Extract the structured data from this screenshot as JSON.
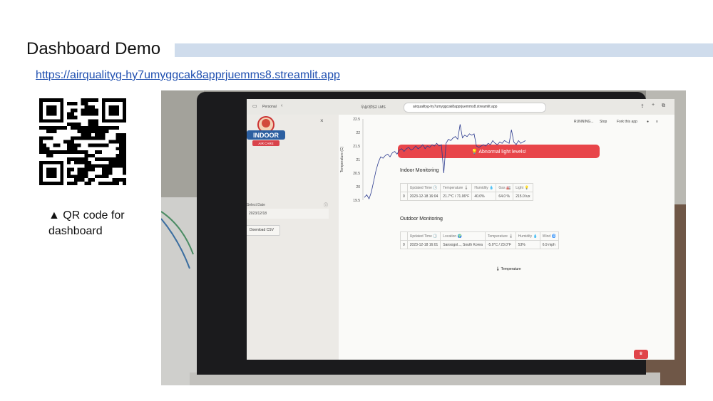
{
  "slide": {
    "title": "Dashboard Demo",
    "link": "https://airqualityg-hy7umyggcak8apprjuemms8.streamlit.app",
    "qr_caption": "▲ QR code for dashboard"
  },
  "browser": {
    "profile": "Personal",
    "tab1": "우송대학교 LMS",
    "url": "airqualityg-hy7umyggcak8apprjuemms8.streamlit.app"
  },
  "app": {
    "status": {
      "running": "RUNNING...",
      "stop": "Stop",
      "fork": "Fork this app"
    },
    "sidebar": {
      "logo_main": "INDOOR",
      "logo_sub": "AIR CARE",
      "select_date_label": "Select Date",
      "date_value": "2023/12/18",
      "download_label": "Download CSV"
    },
    "alert": "💡 Abnormal light levels!",
    "indoor": {
      "heading": "Indoor Monitoring",
      "headers": [
        "",
        "Updated Time 🕒",
        "Temperature 🌡",
        "Humidity 💧",
        "Gas 🏭",
        "Light 💡"
      ],
      "row": [
        "0",
        "2023-12-18 16:04",
        "21.7°C / 71.06°F",
        "40.0%",
        "64.0 %",
        "215.0 lux"
      ]
    },
    "outdoor": {
      "heading": "Outdoor Monitoring",
      "headers": [
        "",
        "Updated Time 🕒",
        "Location 🌍",
        "Temperature 🌡",
        "Humidity 💧",
        "Wind 🌀"
      ],
      "row": [
        "0",
        "2023-12-18 16:01",
        "Sansogol..., South Korea",
        "-5.0°C / 23.0°F",
        "53%",
        "6.9 mph"
      ]
    }
  },
  "chart_data": {
    "type": "line",
    "title": "🌡 Temperature",
    "ylabel": "Temperature (C)",
    "ylim": [
      19.5,
      22.5
    ],
    "yticks": [
      19.5,
      20,
      20.5,
      21,
      21.5,
      22,
      22.5
    ],
    "grid": false,
    "series": [
      {
        "values": [
          19.6,
          19.7,
          19.55,
          19.8,
          20.2,
          20.6,
          20.9,
          21.1,
          21.05,
          21.15,
          21.2,
          21.1,
          21.25,
          21.3,
          21.2,
          21.35,
          21.4,
          21.3,
          21.4,
          21.45,
          21.35,
          21.4,
          21.5,
          21.4,
          21.45,
          21.55,
          21.4,
          21.5,
          21.45,
          21.55,
          21.5,
          21.6,
          21.5,
          21.55,
          20.5,
          21.6,
          21.75,
          21.7,
          21.8,
          21.85,
          21.75,
          22.3,
          21.8,
          21.9,
          21.85,
          21.95,
          21.9,
          21.95,
          21.5,
          21.45,
          21.5,
          21.55,
          21.5,
          21.6,
          21.55,
          21.7,
          21.6,
          21.55,
          21.65,
          21.6,
          21.7,
          21.65,
          21.6,
          22.1,
          21.65,
          21.55,
          21.7,
          21.6,
          21.65,
          21.7
        ]
      }
    ]
  },
  "colors": {
    "title_bar": "#cfdcec",
    "alert": "#e8454a",
    "line": "#2b3a8f",
    "link": "#1f4fb0"
  }
}
